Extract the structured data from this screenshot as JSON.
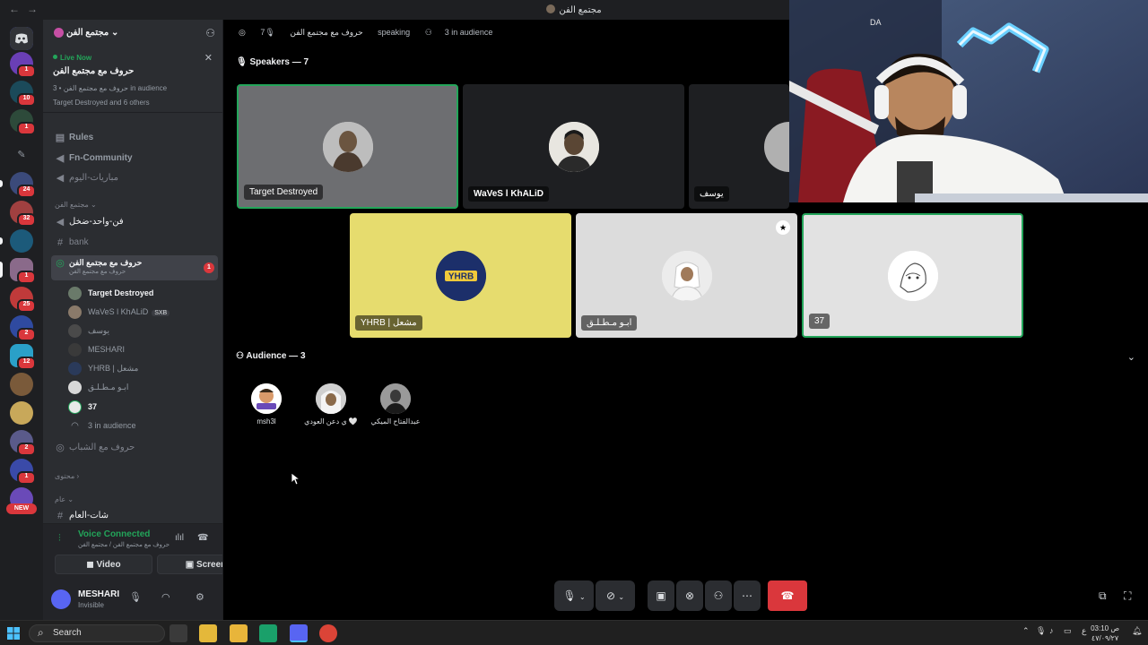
{
  "window": {
    "title": "مجتمع الفن"
  },
  "rail": {
    "badges": [
      "1",
      "10",
      "1",
      "24",
      "32",
      "1",
      "25",
      "2",
      "12",
      "2",
      "1"
    ],
    "new_label": "NEW"
  },
  "server": {
    "name": "مجتمع الفن",
    "live": {
      "status": "Live Now",
      "title": "حروف مع مجتمع الفن",
      "subtitle": "حروف مع مجتمع الفن • 3 in audience",
      "others": "Target Destroyed and 6 others"
    },
    "channels": [
      {
        "label": "Rules"
      },
      {
        "label": "Fn-Community"
      },
      {
        "label": "مباريات-اليوم"
      },
      {
        "label": "مجتمع الفن"
      },
      {
        "label": "فن-واحد-ضخل"
      },
      {
        "label": "bank"
      },
      {
        "label": "حروف مع مجتمع الفن",
        "sub": "حروف مع مجتمع الفن",
        "badge": "1"
      }
    ],
    "voice_users": [
      {
        "name": "Target Destroyed"
      },
      {
        "name": "WaVeS l KhALiD",
        "tag": "SXB"
      },
      {
        "name": "يوسف"
      },
      {
        "name": "MESHARI"
      },
      {
        "name": "YHRB | مشعل"
      },
      {
        "name": "ابـو مـطـلـق"
      },
      {
        "name": "37"
      }
    ],
    "audience_line": "3 in audience",
    "more_channels": [
      {
        "label": "حروف مع الشباب"
      },
      {
        "label": "محتوى"
      },
      {
        "label": "عام"
      },
      {
        "label": "شات-العام"
      }
    ]
  },
  "voice_panel": {
    "status": "Voice Connected",
    "channel": "حروف مع مجتمع الفن / مجتمع الفن",
    "video_label": "Video",
    "screen_label": "Screen"
  },
  "user_panel": {
    "name": "MESHARI",
    "status": "Invisible"
  },
  "stage": {
    "title": "حروف مع مجتمع الفن",
    "speaking": "7 speaking",
    "audience_count": "3 in audience",
    "speakers_header": "Speakers — 7",
    "audience_header": "Audience — 3",
    "speakers": [
      {
        "name": "Target Destroyed"
      },
      {
        "name": "WaVeS l KhALiD"
      },
      {
        "name": "يوسف"
      },
      {
        "name": "YHRB | مشعل"
      },
      {
        "name": "ابـو مـطـلـق"
      },
      {
        "name": "37"
      }
    ],
    "audience": [
      {
        "name": "msh3l"
      },
      {
        "name": "ي دعن العودي 🤍"
      },
      {
        "name": "عبدالفتاح الميكي"
      }
    ]
  },
  "taskbar": {
    "search": "Search",
    "time": "03:10 ص",
    "date": "٤٧/٠٩/٢٧"
  },
  "colors": {
    "green": "#23a55a",
    "red": "#da373c",
    "yhrb_yellow": "#e6dc6e"
  }
}
